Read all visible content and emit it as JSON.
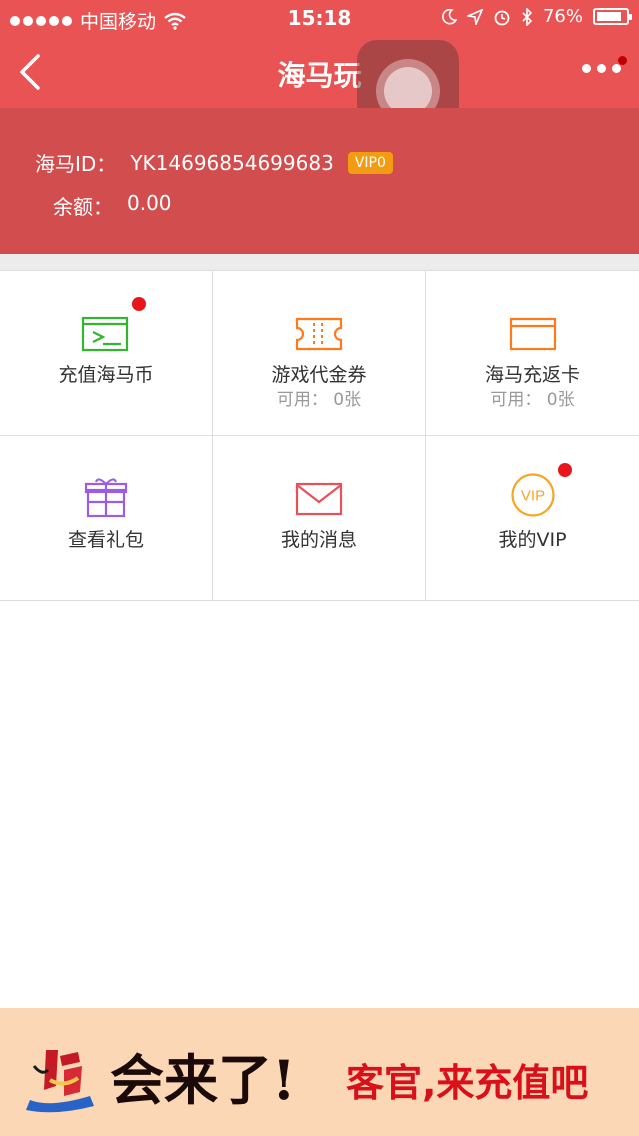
{
  "status_bar": {
    "carrier": "中国移动",
    "time": "15:18",
    "battery": "76%"
  },
  "nav": {
    "title": "海马玩"
  },
  "account": {
    "id_label": "海马ID：",
    "id_value": "YK14696854699683",
    "vip_badge": "VIP0",
    "balance_label": "余额：",
    "balance_value": "0.00"
  },
  "menu": {
    "items": [
      {
        "label": "充值海马币",
        "icon": "recharge-card-icon",
        "color": "#33b52f",
        "badge": true
      },
      {
        "label": "游戏代金券",
        "sub": "可用： 0张",
        "icon": "coupon-ticket-icon",
        "color": "#ff7a1a",
        "badge": false
      },
      {
        "label": "海马充返卡",
        "sub": "可用： 0张",
        "icon": "rebate-card-icon",
        "color": "#ff7a1a",
        "badge": false
      },
      {
        "label": "查看礼包",
        "icon": "gift-box-icon",
        "color": "#9b5de5",
        "badge": false
      },
      {
        "label": "我的消息",
        "icon": "envelope-icon",
        "color": "#e8505b",
        "badge": false
      },
      {
        "label": "我的VIP",
        "icon": "vip-circle-icon",
        "color": "#f5a623",
        "icon_text": "VIP",
        "badge": true
      }
    ]
  },
  "banner": {
    "big_text": "会来了!",
    "small_text": "客官,来充值吧"
  },
  "colors": {
    "primary_red": "#e95353",
    "header_red": "#d24e4e",
    "vip_orange": "#f39c12",
    "badge_red": "#e8161c",
    "banner_bg": "#fbd7b6"
  }
}
